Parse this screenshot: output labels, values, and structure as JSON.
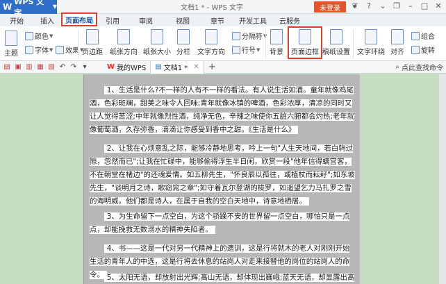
{
  "app": {
    "menu_label": "WPS 文字",
    "doc_title": "文档1 * - WPS 文字",
    "login_label": "未登录"
  },
  "tabs": [
    "开始",
    "插入",
    "页面布局",
    "引用",
    "审阅",
    "视图",
    "章节",
    "开发工具",
    "云服务"
  ],
  "active_tab": "页面布局",
  "ribbon": {
    "theme": "主题",
    "colors": "颜色",
    "fonts": "字体",
    "effects": "效果",
    "margins": "页边距",
    "orientation": "纸张方向",
    "size": "纸张大小",
    "columns": "分栏",
    "text_direction": "文字方向",
    "breaks": "分隔符",
    "line_numbers": "行号",
    "background": "背景",
    "page_border": "页面边框",
    "paper_setup": "稿纸设置",
    "text_wrap": "文字环绕",
    "align": "对齐",
    "group": "组合",
    "rotate": "旋转"
  },
  "doc_tabs": {
    "my_wps": "我的WPS",
    "current": "文档1 *"
  },
  "search_cmd": "点此查找命令",
  "document": {
    "paragraphs": [
      "1、生活是什么?不一样的人有不一样的看法。有人说生活如酒。童年就像鸡尾酒，色彩斑斓，甜美之味令人回味;青年就像冰镇的啤酒，色彩浓厚，清凉的同时又让人觉得苦涩;中年就像烈性酒，纯净无色，辛辣之味使你五脏六腑都会灼热;老年就像葡萄酒，久存弥香，滴滴让你感受到香中之甜。《生活是什么》",
      "2、让我在心烦意乱之际，能够冷静地思考，吟上一句\"人生天地间，若白驹过隙，忽然而已\";让我在忙碌中，能够偷得浮生半日闲，欣赏一段\"他年信得螭宫客，不在朝堂在楮边\"的还魂爱情。如五柳先生，\"怀良辰以孤往，或植杖而耘耔\";如东坡先生，\"谈明月之诗，歌窈窕之章\";如守着瓦尔登湖的梭罗，如遥望乞力马扎罗之雪的海明威。他们都是诗人，在属于自我的空白天地中，诗意地栖居。",
      "3、为生命留下一点空白，为这个骄躁不安的世界留一点空白，哪怕只是一点点，却能挽救无数溺水的精神失陷者。",
      "4、书——这是一代对另一代精神上的遗训，这是行将就木的老人对刚刚开始生活的青年人的中选，这是行将去休息的站岗人对走来接替他的岗位的站岗人的命令。",
      "5、太阳无语，却放射出光辉;高山无语，却体现出巍峨;蓝天无语，却显露出高远;"
    ]
  }
}
